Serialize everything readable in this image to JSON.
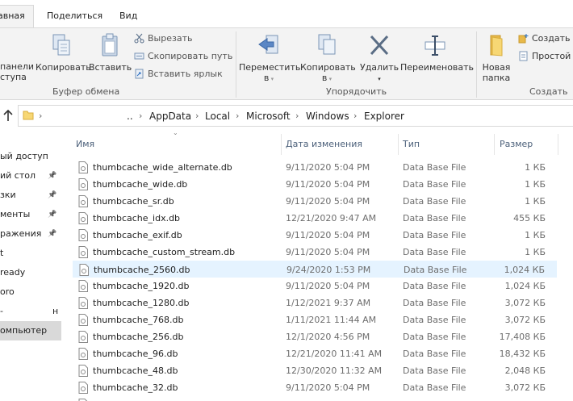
{
  "ribbon_tabs": [
    "авная",
    "Поделиться",
    "Вид"
  ],
  "ribbon": {
    "clipboard": {
      "pin_label_1": "панели",
      "pin_label_2": "ступа",
      "copy": "Копировать",
      "paste": "Вставить",
      "cut": "Вырезать",
      "copy_path": "Скопировать путь",
      "paste_shortcut": "Вставить ярлык",
      "group_label": "Буфер обмена"
    },
    "organize": {
      "move_1": "Переместить",
      "move_2": "в",
      "copy_to_1": "Копировать",
      "copy_to_2": "в",
      "delete": "Удалить",
      "rename": "Переименовать",
      "group_label": "Упорядочить"
    },
    "create": {
      "new_folder_1": "Новая",
      "new_folder_2": "папка",
      "new_item": "Создать э",
      "easy_access": "Простой д",
      "group_label": "Создать"
    }
  },
  "address": {
    "ellipsis": "..",
    "crumbs": [
      "AppData",
      "Local",
      "Microsoft",
      "Windows",
      "Explorer"
    ]
  },
  "nav_items": [
    {
      "label": "ый доступ",
      "pinned": false
    },
    {
      "label": "ий стол",
      "pinned": true
    },
    {
      "label": "зки",
      "pinned": true
    },
    {
      "label": "менты",
      "pinned": true
    },
    {
      "label": "ражения",
      "pinned": true
    },
    {
      "label": "t",
      "pinned": false
    },
    {
      "label": "ready",
      "pinned": false
    },
    {
      "label": "oro",
      "pinned": false
    },
    {
      "label": "-",
      "pinned": false,
      "right": "н"
    },
    {
      "label": "омпьютер",
      "pinned": false,
      "selected": true
    }
  ],
  "columns": {
    "name": "Имя",
    "date": "Дата изменения",
    "type": "Тип",
    "size": "Размер"
  },
  "files": [
    {
      "name": "thumbcache_wide_alternate.db",
      "date": "9/11/2020 5:04 PM",
      "type": "Data Base File",
      "size": "1 КБ"
    },
    {
      "name": "thumbcache_wide.db",
      "date": "9/11/2020 5:04 PM",
      "type": "Data Base File",
      "size": "1 КБ"
    },
    {
      "name": "thumbcache_sr.db",
      "date": "9/11/2020 5:04 PM",
      "type": "Data Base File",
      "size": "1 КБ"
    },
    {
      "name": "thumbcache_idx.db",
      "date": "12/21/2020 9:47 AM",
      "type": "Data Base File",
      "size": "455 КБ"
    },
    {
      "name": "thumbcache_exif.db",
      "date": "9/11/2020 5:04 PM",
      "type": "Data Base File",
      "size": "1 КБ"
    },
    {
      "name": "thumbcache_custom_stream.db",
      "date": "9/11/2020 5:04 PM",
      "type": "Data Base File",
      "size": "1 КБ"
    },
    {
      "name": "thumbcache_2560.db",
      "date": "9/24/2020 1:53 PM",
      "type": "Data Base File",
      "size": "1,024 КБ",
      "selected": true
    },
    {
      "name": "thumbcache_1920.db",
      "date": "9/11/2020 5:04 PM",
      "type": "Data Base File",
      "size": "1,024 КБ"
    },
    {
      "name": "thumbcache_1280.db",
      "date": "1/12/2021 9:37 AM",
      "type": "Data Base File",
      "size": "3,072 КБ"
    },
    {
      "name": "thumbcache_768.db",
      "date": "1/11/2021 11:44 AM",
      "type": "Data Base File",
      "size": "3,072 КБ"
    },
    {
      "name": "thumbcache_256.db",
      "date": "12/1/2020 4:56 PM",
      "type": "Data Base File",
      "size": "17,408 КБ"
    },
    {
      "name": "thumbcache_96.db",
      "date": "12/21/2020 11:41 AM",
      "type": "Data Base File",
      "size": "18,432 КБ"
    },
    {
      "name": "thumbcache_48.db",
      "date": "12/30/2020 11:32 AM",
      "type": "Data Base File",
      "size": "2,048 КБ"
    },
    {
      "name": "thumbcache_32.db",
      "date": "9/11/2020 5:04 PM",
      "type": "Data Base File",
      "size": "3,072 КБ"
    }
  ],
  "colors": {
    "selection": "#e5f3ff",
    "folder": "#f7d774",
    "accent": "#0078d7"
  }
}
